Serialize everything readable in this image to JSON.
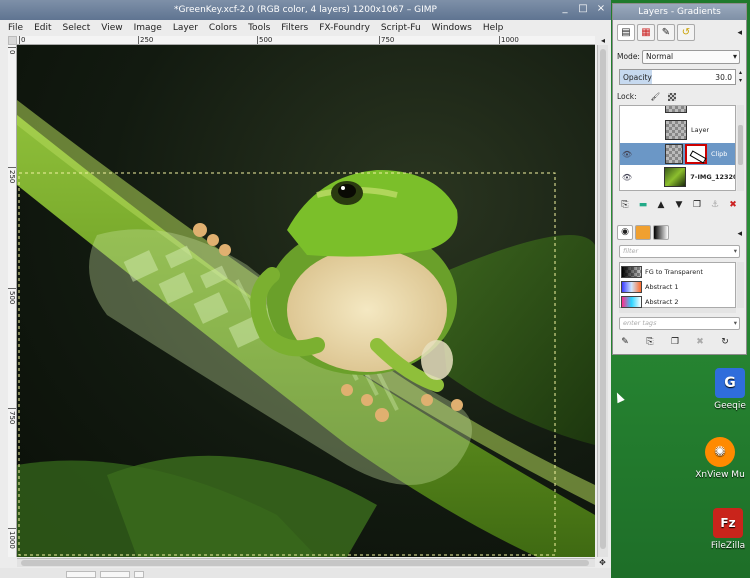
{
  "window": {
    "title": "*GreenKey.xcf-2.0 (RGB color, 4 layers) 1200x1067 – GIMP",
    "controls": {
      "minimize": "_",
      "maximize": "□",
      "close": "×"
    }
  },
  "menu": [
    "File",
    "Edit",
    "Select",
    "View",
    "Image",
    "Layer",
    "Colors",
    "Tools",
    "Filters",
    "FX-Foundry",
    "Script-Fu",
    "Windows",
    "Help"
  ],
  "rulers": {
    "horizontal": [
      "0",
      "250",
      "500",
      "750",
      "1000"
    ],
    "vertical": [
      "0",
      "250",
      "500",
      "750",
      "1000"
    ]
  },
  "dock": {
    "title": "Layers - Gradients",
    "mode_label": "Mode:",
    "mode_value": "Normal",
    "opacity_label": "Opacity",
    "opacity_value": "30.0",
    "lock_label": "Lock:",
    "layers": [
      {
        "name": "Layer",
        "visible": false,
        "selected": false
      },
      {
        "name": "Clipb",
        "visible": true,
        "selected": true
      },
      {
        "name": "7-IMG_12320",
        "visible": true,
        "selected": false
      }
    ],
    "filter_placeholder": "filter",
    "gradients": [
      {
        "name": "FG to Transparent",
        "colors": [
          "#000000",
          "#ffffff"
        ]
      },
      {
        "name": "Abstract 1",
        "colors": [
          "#3b3bff",
          "#cfe8ff",
          "#ff6a2a"
        ]
      },
      {
        "name": "Abstract 2",
        "colors": [
          "#ff2b8a",
          "#2ad4ff",
          "#ffffff"
        ]
      }
    ],
    "tags_placeholder": "enter tags"
  },
  "desktop": {
    "icons": [
      {
        "label": "Geeqie",
        "color": "#2f6ddb",
        "glyph": "G"
      },
      {
        "label": "XnView Mu",
        "color": "#ff8a00",
        "glyph": "✺"
      },
      {
        "label": "FileZilla",
        "color": "#c9241b",
        "glyph": "Fz"
      }
    ]
  }
}
